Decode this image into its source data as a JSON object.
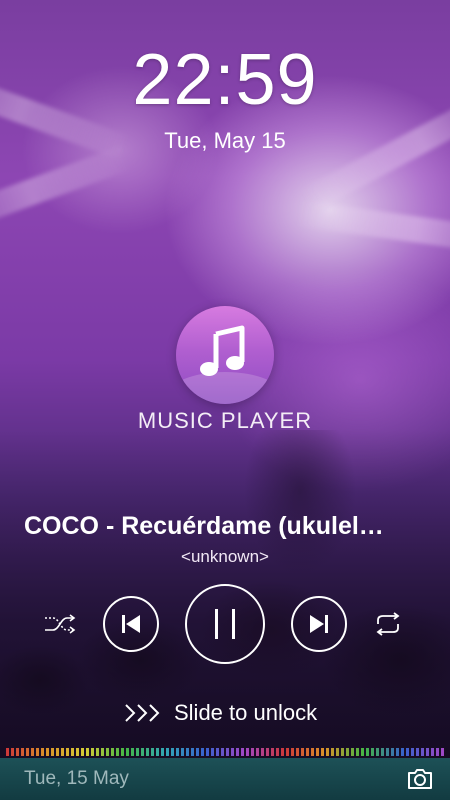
{
  "lockscreen": {
    "time": "22:59",
    "date": "Tue, May 15"
  },
  "app": {
    "logo_text": "MUSIC PLAYER",
    "logo_icon": "music-note-icon"
  },
  "track": {
    "title": "COCO - Recuérdame (ukulel…",
    "artist": "<unknown>"
  },
  "controls": {
    "shuffle_icon": "shuffle-icon",
    "previous_icon": "skip-previous-icon",
    "play_pause_icon": "pause-icon",
    "next_icon": "skip-next-icon",
    "repeat_icon": "repeat-icon"
  },
  "unlock": {
    "label": "Slide to unlock",
    "icon": "chevrons-right-icon"
  },
  "bottom_bar": {
    "date": "Tue, 15 May",
    "camera_icon": "camera-icon",
    "color": "#1d5157"
  }
}
